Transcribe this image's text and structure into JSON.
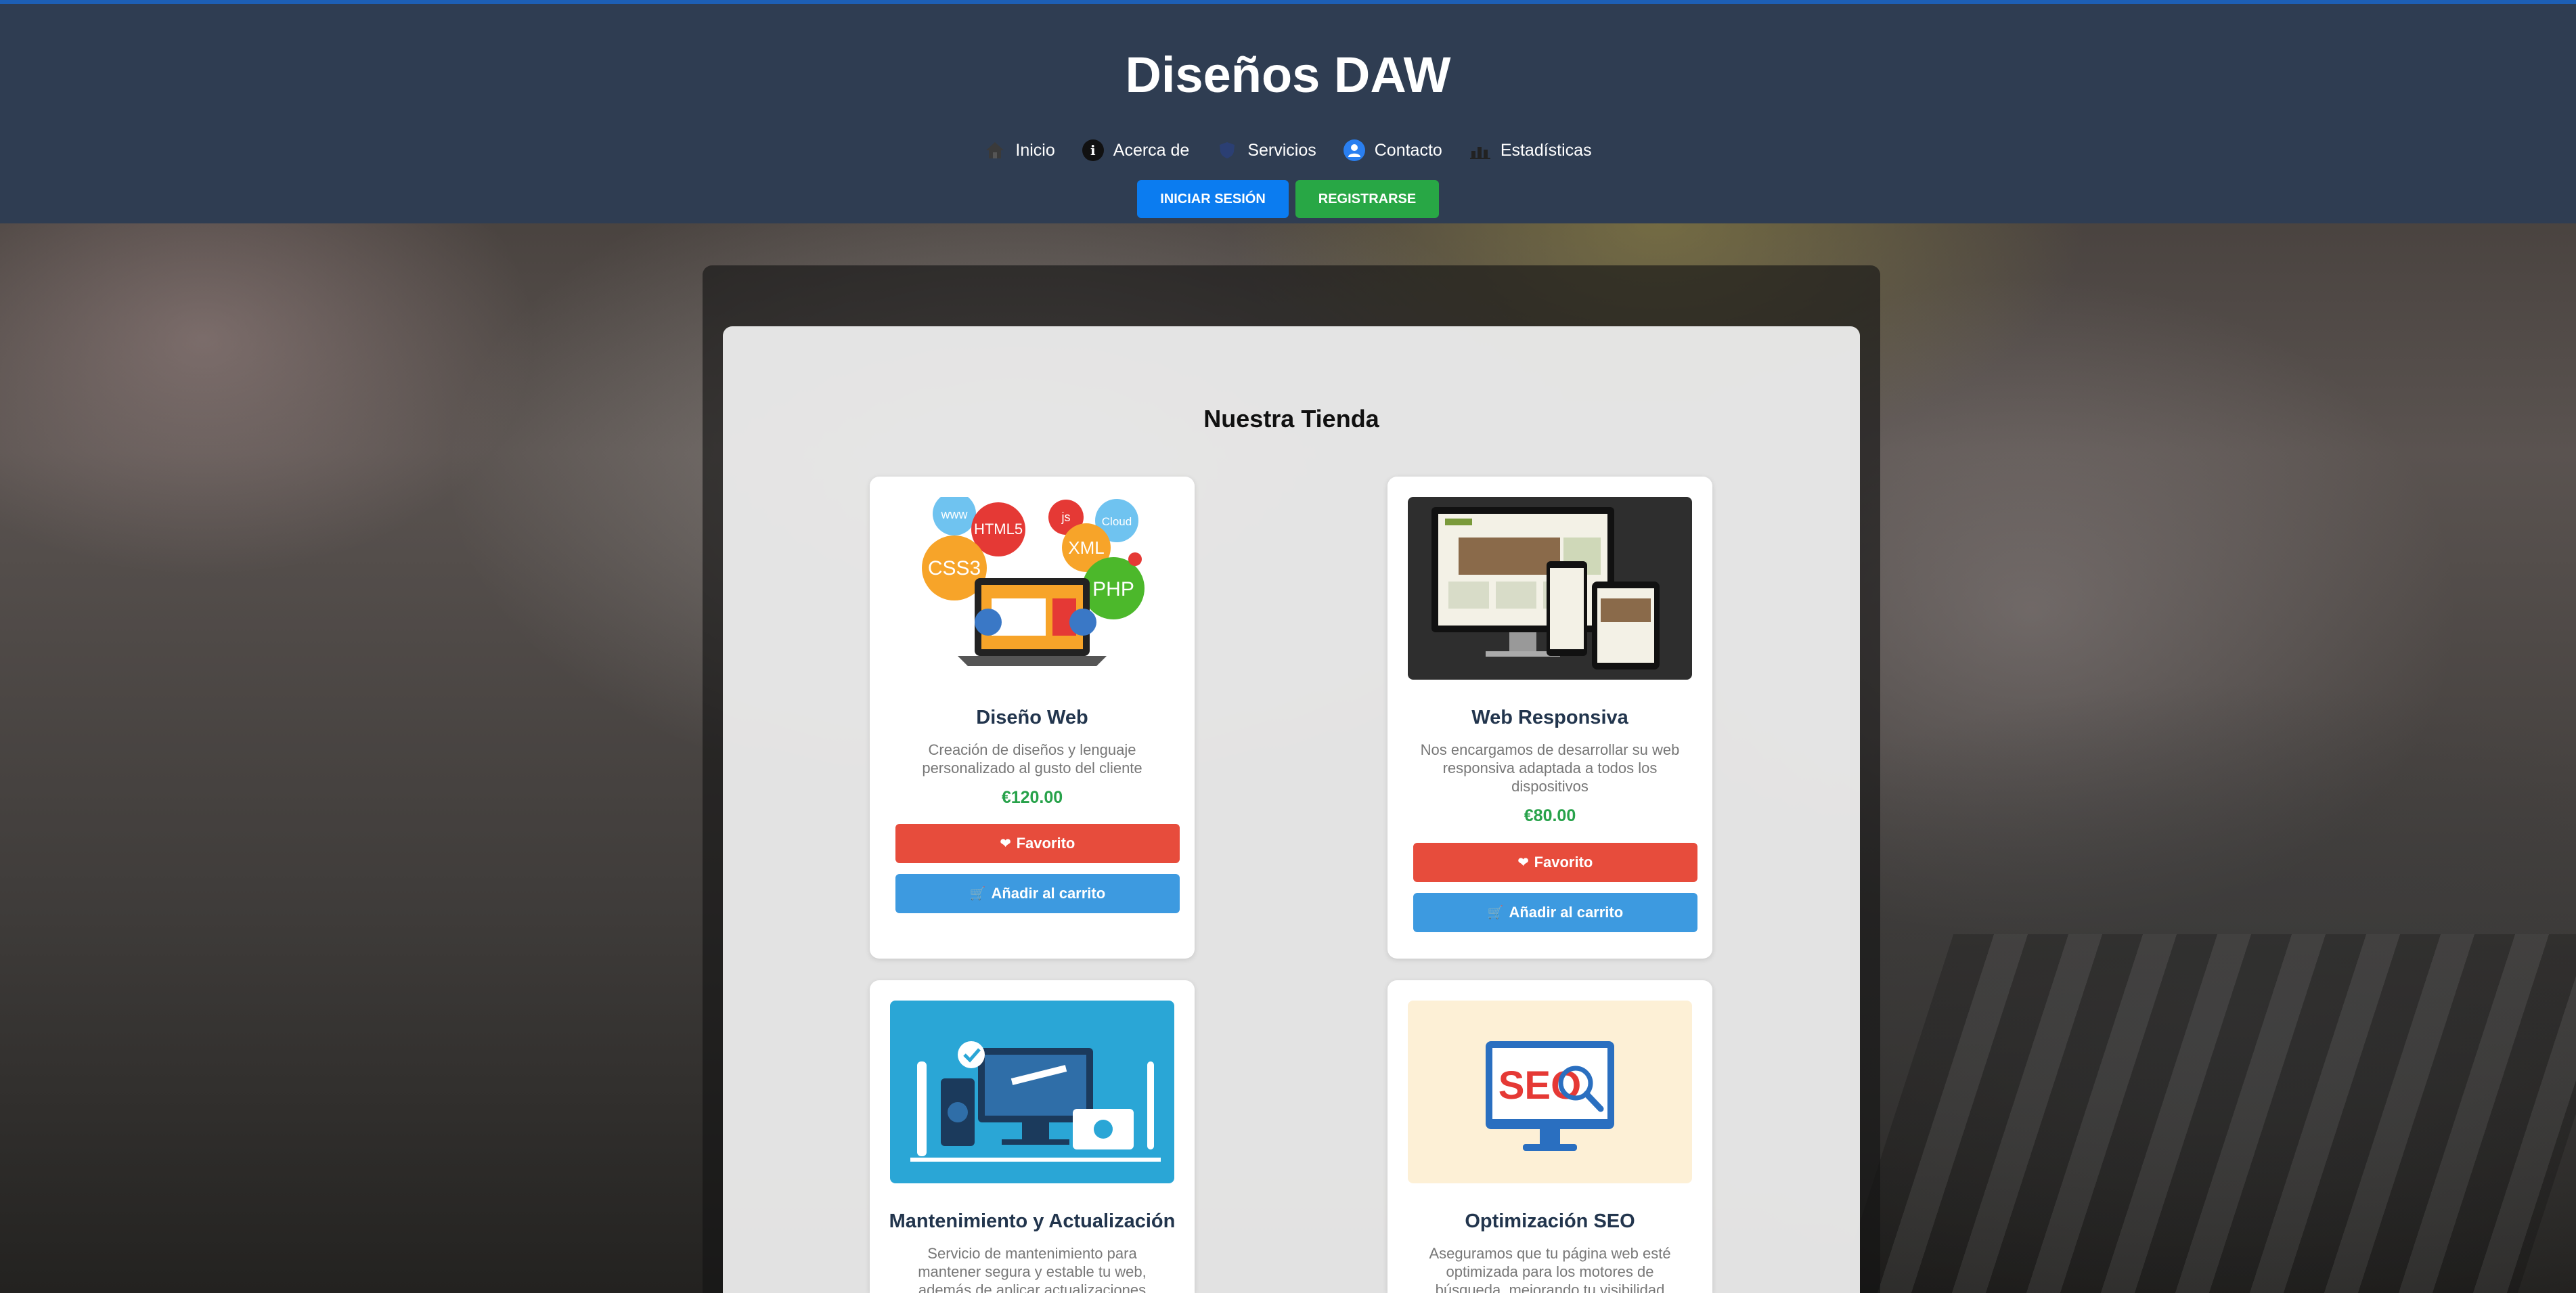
{
  "site": {
    "title": "Diseños DAW"
  },
  "nav": {
    "items": [
      {
        "label": "Inicio",
        "icon": "home-icon"
      },
      {
        "label": "Acerca de",
        "icon": "info-icon"
      },
      {
        "label": "Servicios",
        "icon": "shield-icon"
      },
      {
        "label": "Contacto",
        "icon": "user-icon"
      },
      {
        "label": "Estadísticas",
        "icon": "chart-icon"
      }
    ]
  },
  "auth": {
    "login_label": "Iniciar sesión",
    "register_label": "Registrarse"
  },
  "store": {
    "title": "Nuestra Tienda",
    "favorite_label": "Favorito",
    "cart_label": "Añadir al carrito",
    "products": [
      {
        "title": "Diseño Web",
        "description": "Creación de diseños y lenguaje personalizado al gusto del cliente",
        "price": "€120.00",
        "image_labels": [
          "www",
          "HTML5",
          "js",
          "Cloud",
          "CSS3",
          "XML",
          "PHP"
        ]
      },
      {
        "title": "Web Responsiva",
        "description": "Nos encargamos de desarrollar su web responsiva adaptada a todos los dispositivos",
        "price": "€80.00"
      },
      {
        "title": "Mantenimiento y Actualización",
        "description": "Servicio de mantenimiento para mantener segura y estable tu web, además de aplicar actualizaciones"
      },
      {
        "title": "Optimización SEO",
        "description": "Aseguramos que tu página web esté optimizada para los motores de búsqueda, mejorando tu visibilidad",
        "image_labels": [
          "SEO"
        ]
      }
    ]
  },
  "colors": {
    "header_bg": "#2f3d52",
    "login_button": "#0b7cf0",
    "register_button": "#28a745",
    "favorite_button": "#e74c3c",
    "cart_button": "#3d9ae0",
    "price": "#27a24a"
  }
}
